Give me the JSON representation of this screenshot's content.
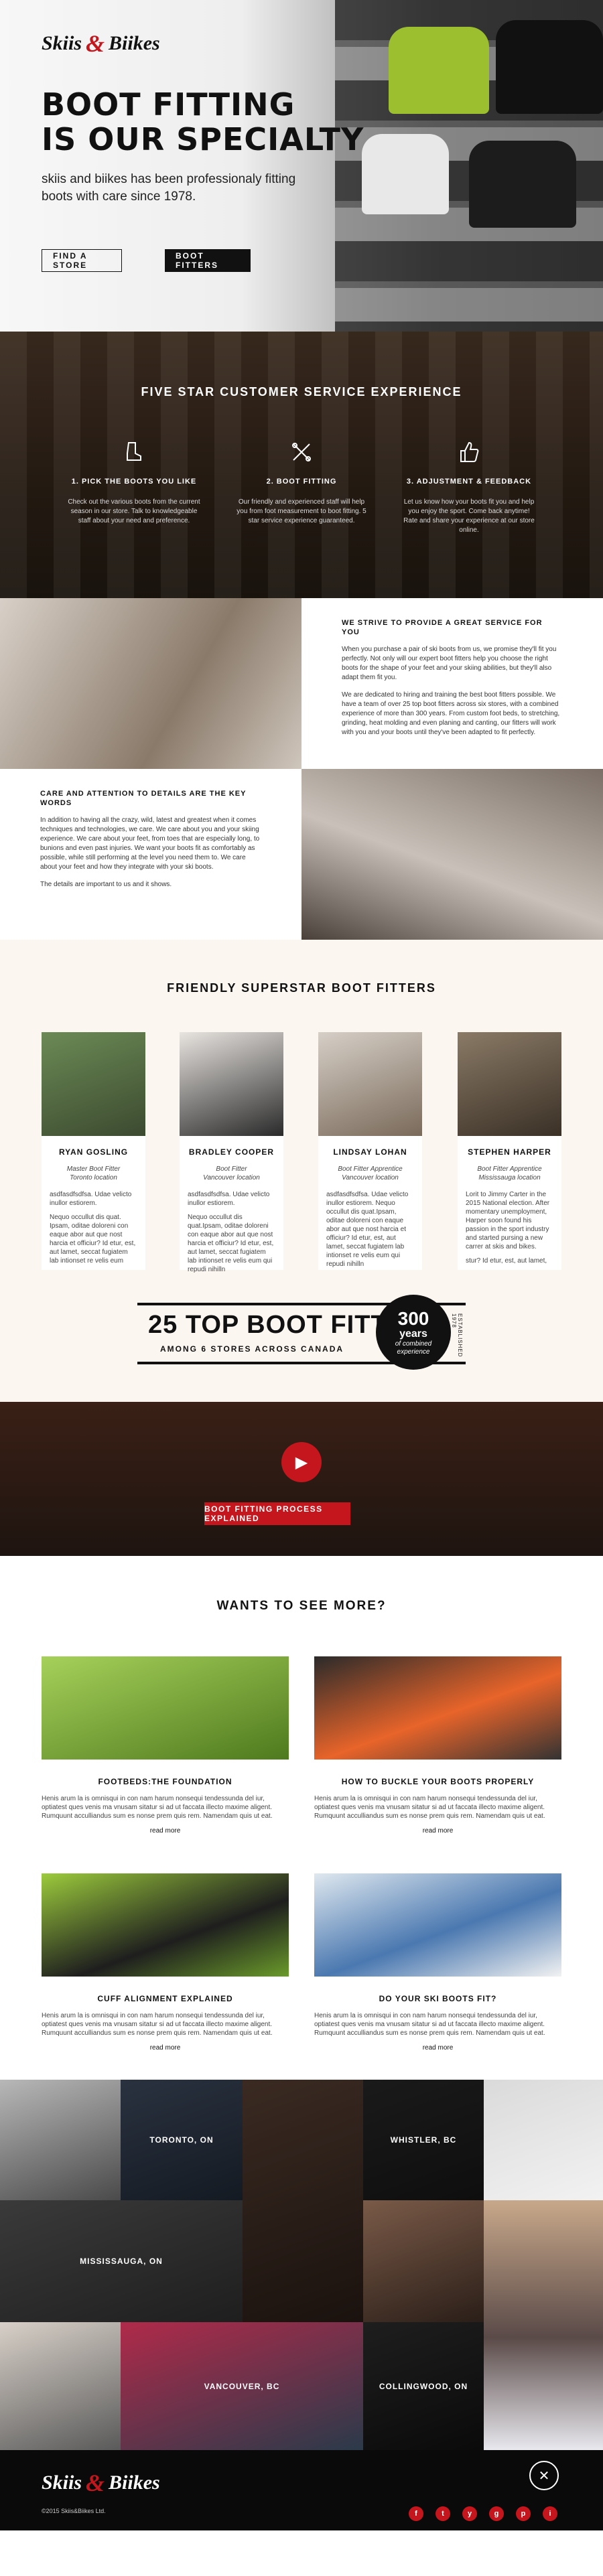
{
  "brand": {
    "name_a": "Skiis",
    "amp": "&",
    "name_b": "Biikes",
    "accent": "#c4161c"
  },
  "hero": {
    "title_line1": "BOOT FITTING",
    "title_line2": "IS OUR SPECIALTY",
    "subtitle": "skiis and biikes has been professionaly fitting boots with care since 1978.",
    "find_store": "FIND A STORE",
    "boot_fitters": "BOOT FITTERS"
  },
  "five_star": {
    "title": "FIVE STAR CUSTOMER SERVICE EXPERIENCE",
    "steps": [
      {
        "icon": "boot-icon",
        "title": "1. PICK THE BOOTS YOU LIKE",
        "desc": "Check out the various boots from the current season in our store. Talk to knowledgeable staff about your need and preference."
      },
      {
        "icon": "tools-icon",
        "title": "2. BOOT FITTING",
        "desc": "Our friendly and experienced staff will help you from foot measurement to boot fitting. 5 star service experience guaranteed."
      },
      {
        "icon": "thumbs-up-icon",
        "title": "3. ADJUSTMENT & FEEDBACK",
        "desc": "Let us know how your boots fit you and help you enjoy the sport. Come back anytime! Rate and share your experience at our store online."
      }
    ]
  },
  "service": {
    "title": "WE STRIVE TO PROVIDE A GREAT SERVICE FOR YOU",
    "p1": "When you purchase a pair of ski boots from us, we promise they'll fit you perfectly. Not only will our expert boot fitters help you choose the right boots for the shape of your feet and your skiing abilities, but they'll also adapt them fit you.",
    "p2": "We are dedicated to hiring and training the best boot fitters possible. We have a team of over 25 top boot fitters across six stores, with a combined experience of more than 300 years. From custom foot beds, to stretching, grinding, heat molding and even planing and canting, our fitters will work with you and your boots until they've been adapted to fit perfectly."
  },
  "care": {
    "title": "CARE AND ATTENTION TO DETAILS ARE THE KEY WORDS",
    "p1": "In addition to having all the crazy, wild, latest and greatest when it comes techniques and technologies, we care. We care about you and your skiing experience. We care about your feet, from toes that are especially long, to bunions and even past injuries. We want your boots fit as comfortably as possible, while still performing at the level you need them to. We care about your feet and how they integrate with your ski boots.",
    "p2": "The details are important to us and it shows."
  },
  "team": {
    "title": "FRIENDLY SUPERSTAR BOOT FITTERS",
    "members": [
      {
        "name": "RYAN GOSLING",
        "role1": "Master Boot Fitter",
        "role2": "Toronto location",
        "bio1": "asdfasdfsdfsa. Udae velicto inullor estiorem.",
        "bio2": "Nequo occullut dis quat. Ipsam, oditae doloreni con eaque abor aut que nost harcia et officiur? Id etur, est, aut lamet, seccat fugiatem lab intionset re velis eum"
      },
      {
        "name": "BRADLEY COOPER",
        "role1": "Boot Fitter",
        "role2": "Vancouver location",
        "bio1": "asdfasdfsdfsa. Udae velicto inullor estiorem.",
        "bio2": "Nequo occullut dis quat.Ipsam, oditae doloreni con eaque abor aut que nost harcia et officiur? Id etur, est, aut lamet, seccat fugiatem lab intionset re velis eum qui repudi nihilln"
      },
      {
        "name": "LINDSAY LOHAN",
        "role1": "Boot Fitter Apprentice",
        "role2": "Vancouver location",
        "bio1": "asdfasdfsdfsa. Udae velicto inullor estiorem. Nequo occullut dis quat.Ipsam, oditae doloreni con eaque abor aut que nost harcia et officiur? Id etur, est, aut lamet, seccat fugiatem lab intionset re velis eum qui repudi nihilln",
        "bio2": ""
      },
      {
        "name": "STEPHEN HARPER",
        "role1": "Boot Fitter Apprentice",
        "role2": "Mississauga location",
        "bio1": "Lorit to Jimmy Carter in the 2015 National election. After momentary unemployment, Harper soon found his passion in the sport industry and started pursing a new carrer at skis and bikes.",
        "bio2": "stur? Id etur, est, aut lamet,"
      }
    ]
  },
  "badge": {
    "big": "25 TOP BOOT FITTERS",
    "small": "AMONG 6 STORES ACROSS CANADA",
    "seal_num": "300",
    "seal_years": "years",
    "seal_c1": "of combined",
    "seal_c2": "experience",
    "est": "ESTABLISHED 1978"
  },
  "video": {
    "button": "BOOT FITTING PROCESS EXPLAINED"
  },
  "more": {
    "title": "WANTS TO SEE MORE?",
    "articles": [
      {
        "title": "FOOTBEDS:THE FOUNDATION",
        "desc": "Henis arum la is omnisqui in con nam harum nonsequi tendessunda del iur, optiatest ques venis ma vnusam sitatur si ad ut faccata illecto maxime aligent. Rumquunt acculliandus sum es nonse prem quis rem. Namendam quis ut eat.",
        "more": "read more"
      },
      {
        "title": "HOW TO BUCKLE YOUR BOOTS PROPERLY",
        "desc": "Henis arum la is omnisqui in con nam harum nonsequi tendessunda del iur, optiatest ques venis ma vnusam sitatur si ad ut faccata illecto maxime aligent. Rumquunt acculliandus sum es nonse prem quis rem. Namendam quis ut eat.",
        "more": "read more"
      },
      {
        "title": "CUFF ALIGNMENT EXPLAINED",
        "desc": "Henis arum la is omnisqui in con nam harum nonsequi tendessunda del iur, optiatest ques venis ma vnusam sitatur si ad ut faccata illecto maxime aligent. Rumquunt acculliandus sum es nonse prem quis rem. Namendam quis ut eat.",
        "more": "read more"
      },
      {
        "title": "DO YOUR SKI BOOTS FIT?",
        "desc": "Henis arum la is omnisqui in con nam harum nonsequi tendessunda del iur, optiatest ques venis ma vnusam sitatur si ad ut faccata illecto maxime aligent. Rumquunt acculliandus sum es nonse prem quis rem. Namendam quis ut eat.",
        "more": "read more"
      }
    ]
  },
  "locations": {
    "toronto": "TORONTO, ON",
    "whistler": "WHISTLER, BC",
    "mississauga": "MISSISSAUGA, ON",
    "vancouver": "VANCOUVER, BC",
    "collingwood": "COLLINGWOOD, ON"
  },
  "footer": {
    "copyright": "©2015 Skiis&Biikes Ltd.",
    "social": [
      "f",
      "t",
      "y",
      "g",
      "p",
      "i"
    ]
  }
}
